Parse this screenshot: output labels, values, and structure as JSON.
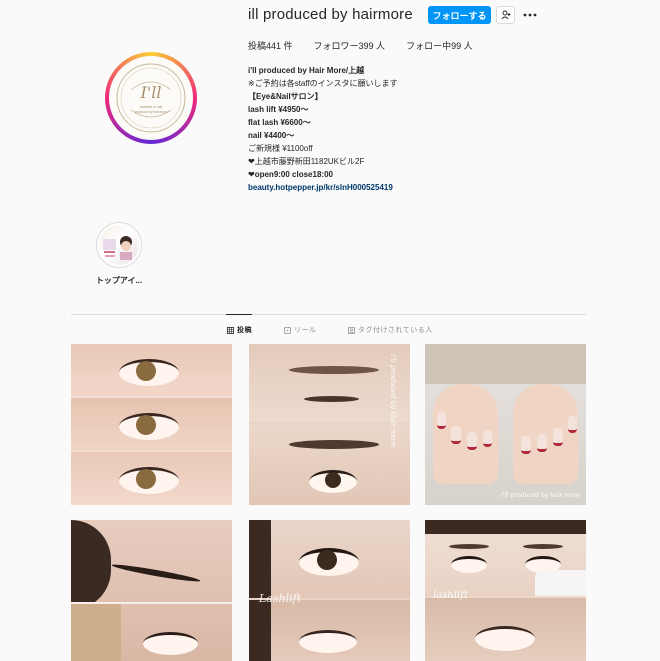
{
  "header": {
    "username": "ill produced by hairmore",
    "follow_label": "フォローする",
    "stats": {
      "posts": "投稿441 件",
      "followers": "フォロワー399 人",
      "following": "フォロー中99 人"
    }
  },
  "bio": {
    "name": "i'll produced by Hair More/上越",
    "lines": [
      "※ご予約は各staffのインスタに願いします",
      "【Eye&Nailサロン】",
      "lash lift ¥4950〜",
      "flat lash ¥6600〜",
      "nail ¥4400〜",
      "ご新規様 ¥1100off",
      "❤上越市藤野新田1182UKビル2F",
      "❤open9:00 close18:00"
    ],
    "link": "beauty.hotpepper.jp/kr/slnH000525419"
  },
  "avatar_logo": {
    "script": "I'll",
    "line1": "eyelash & nail",
    "line2": "produced by hair more"
  },
  "highlights": [
    {
      "label": "トップアイ..."
    }
  ],
  "tabs": [
    {
      "label": "投稿",
      "icon": "grid-icon",
      "active": true
    },
    {
      "label": "リール",
      "icon": "reels-icon",
      "active": false
    },
    {
      "label": "タグ付けされている人",
      "icon": "tagged-icon",
      "active": false
    }
  ],
  "posts": [
    {
      "overlay_text": ""
    },
    {
      "overlay_text": "i'll produced by Hair more"
    },
    {
      "overlay_text": "i'll produced by hair more"
    },
    {
      "overlay_text": ""
    },
    {
      "overlay_text": "Lashlift"
    },
    {
      "overlay_text": "lashlift"
    }
  ],
  "colors": {
    "accent": "#0095f6",
    "link": "#00376b",
    "nail_red": "#b0283a"
  }
}
